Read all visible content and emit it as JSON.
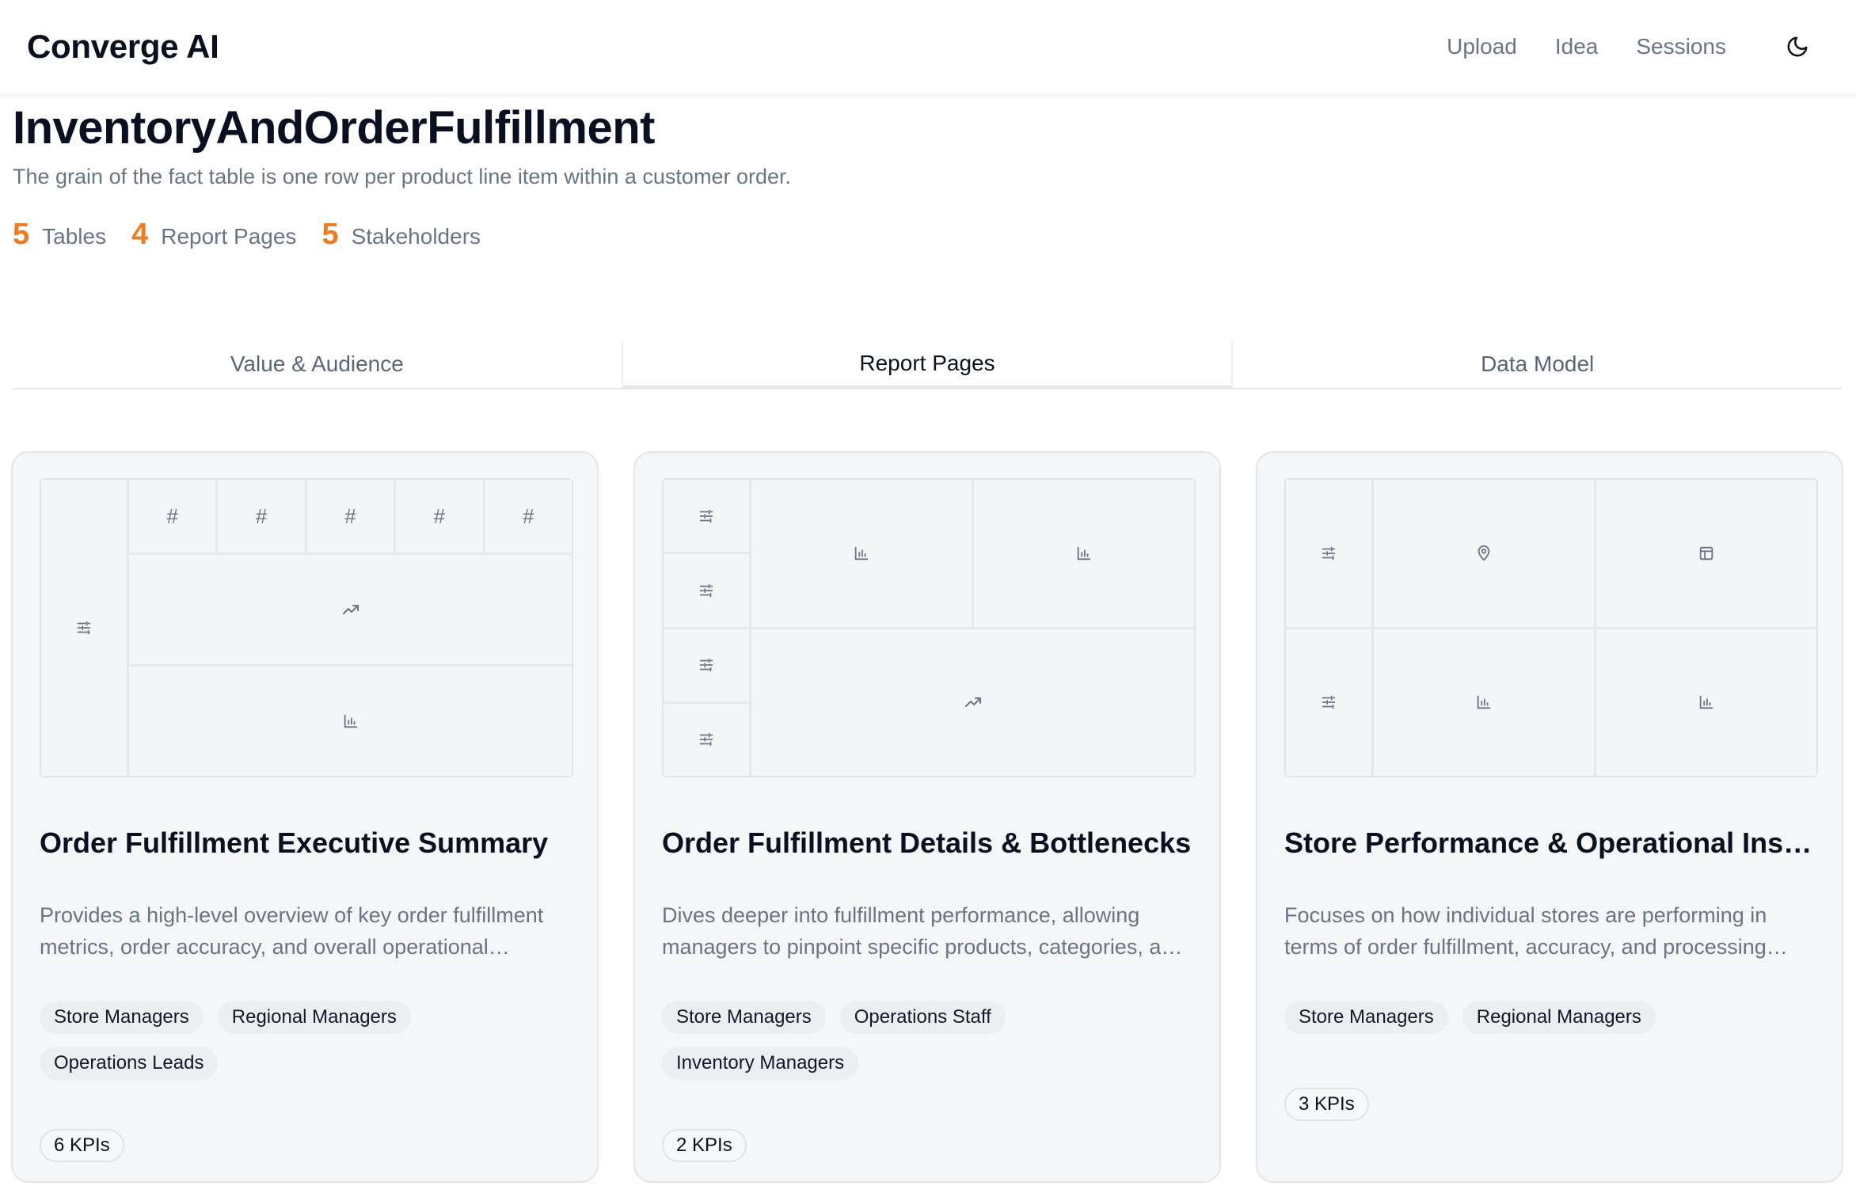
{
  "app": {
    "brand": "Converge AI",
    "nav": [
      "Upload",
      "Idea",
      "Sessions"
    ],
    "theme_icon": "moon-icon"
  },
  "project": {
    "title": "InventoryAndOrderFulfillment",
    "subtitle": "The grain of the fact table is one row per product line item within a customer order.",
    "stats": [
      {
        "value": "5",
        "label": "Tables"
      },
      {
        "value": "4",
        "label": "Report Pages"
      },
      {
        "value": "5",
        "label": "Stakeholders"
      }
    ]
  },
  "tabs": [
    {
      "label": "Value & Audience",
      "active": false
    },
    {
      "label": "Report Pages",
      "active": true
    },
    {
      "label": "Data Model",
      "active": false
    }
  ],
  "colors": {
    "accent": "#f07a20"
  },
  "cards": [
    {
      "title": "Order Fulfillment Executive Summary",
      "description": "Provides a high-level overview of key order fulfillment metrics, order accuracy, and overall operational efficiency.",
      "tags": [
        "Store Managers",
        "Regional Managers",
        "Operations Leads"
      ],
      "kpis": "6 KPIs",
      "layout_icons": [
        "slider-icon",
        "hash-icon",
        "hash-icon",
        "hash-icon",
        "hash-icon",
        "hash-icon",
        "trend-icon",
        "bar-chart-icon"
      ]
    },
    {
      "title": "Order Fulfillment Details & Bottlenecks",
      "description": "Dives deeper into fulfillment performance, allowing managers to pinpoint specific products, categories, and stores.",
      "tags": [
        "Store Managers",
        "Operations Staff",
        "Inventory Managers"
      ],
      "kpis": "2 KPIs",
      "layout_icons": [
        "slider-icon",
        "slider-icon",
        "slider-icon",
        "slider-icon",
        "bar-chart-icon",
        "bar-chart-icon",
        "trend-icon"
      ]
    },
    {
      "title": "Store Performance & Operational Insights",
      "description": "Focuses on how individual stores are performing in terms of order fulfillment, accuracy, and processing time.",
      "tags": [
        "Store Managers",
        "Regional Managers"
      ],
      "kpis": "3 KPIs",
      "layout_icons": [
        "slider-icon",
        "slider-icon",
        "map-pin-icon",
        "table-icon",
        "bar-chart-icon",
        "bar-chart-icon"
      ]
    }
  ]
}
